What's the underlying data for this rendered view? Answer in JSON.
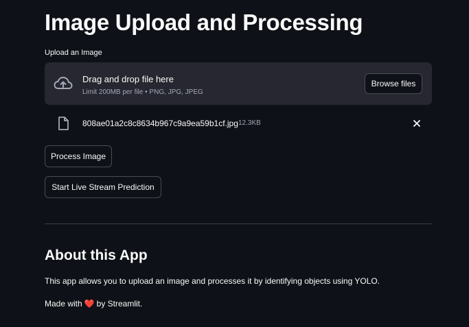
{
  "page": {
    "title": "Image Upload and Processing"
  },
  "uploader": {
    "label": "Upload an Image",
    "drop_title": "Drag and drop file here",
    "limit_text": "Limit 200MB per file • PNG, JPG, JPEG",
    "browse_label": "Browse files",
    "icon": "cloud-upload-icon"
  },
  "file": {
    "name": "808ae01a2c8c8634b967c9a9ea59b1cf.jpg",
    "size": "12.3KB",
    "icon": "file-icon",
    "remove_icon": "close-icon"
  },
  "buttons": {
    "process": "Process Image",
    "stream": "Start Live Stream Prediction"
  },
  "about": {
    "title": "About this App",
    "description": "This app allows you to upload an image and processes it by identifying objects using YOLO.",
    "made_with_prefix": "Made with",
    "heart": "❤️",
    "made_with_suffix": "by Streamlit."
  },
  "colors": {
    "background": "#0e1117",
    "dropzone": "#262730",
    "text": "#fafafa",
    "muted": "#a3a8b8",
    "heart": "#e0243a"
  }
}
